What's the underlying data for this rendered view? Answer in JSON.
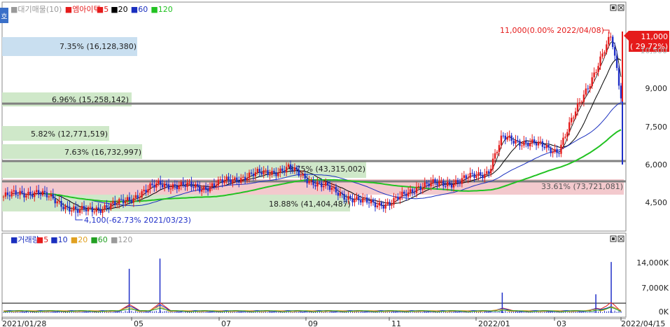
{
  "colors": {
    "up": "#e51b1b",
    "down": "#2030c8",
    "ma5": "#000000",
    "ma20": "#000000",
    "ma60": "#1a2fbf",
    "ma120": "#22c222",
    "band_green": "#cfe8c9",
    "band_pink": "#f3c9cd",
    "band_blue": "#c9dff0",
    "level_line": "#888888",
    "price_tag": "#e51b1b"
  },
  "price_panel": {
    "legend": [
      {
        "text": "■대기매물(10)",
        "color": "#9a9a9a"
      },
      {
        "text": "■엠아이텍",
        "color": "#e51b1b"
      },
      {
        "text": "■5",
        "color": "#e51b1b"
      },
      {
        "text": "■20",
        "color": "#000000"
      },
      {
        "text": "■60",
        "color": "#1a2fbf"
      },
      {
        "text": "■120",
        "color": "#22c222"
      }
    ],
    "side_tab": "호",
    "y_ticks": [
      "9,000",
      "7,500",
      "6,000",
      "4,500"
    ],
    "price_tag": {
      "line1": "11,000",
      "line2": "( 29.72%)"
    },
    "max_annotation": "11,000(0.00% 2022/04/08)",
    "min_annotation": "4,100(-62.73% 2021/03/23)",
    "volume_profile": [
      {
        "label": "7.35% (16,128,380)",
        "color": "blue"
      },
      {
        "label": "6.96% (15,258,142)",
        "color": "green"
      },
      {
        "label": "5.82% (12,771,519)",
        "color": "green"
      },
      {
        "label": "7.63% (16,732,997)",
        "color": "green"
      },
      {
        "label": "9.75% (43,315,002)",
        "color": "green"
      },
      {
        "label": "33.61% (73,721,081)",
        "color": "pink"
      },
      {
        "label": "18.88% (41,404,487)",
        "color": "green"
      }
    ]
  },
  "volume_panel": {
    "legend": [
      {
        "text": "■거래량",
        "color": "#1a2fbf"
      },
      {
        "text": "■5",
        "color": "#e51b1b"
      },
      {
        "text": "■10",
        "color": "#1a2fbf"
      },
      {
        "text": "■20",
        "color": "#e0a020"
      },
      {
        "text": "■60",
        "color": "#22a022"
      },
      {
        "text": "■120",
        "color": "#9a9a9a"
      }
    ],
    "y_ticks": [
      "14,000K",
      "7,000K",
      "0K"
    ]
  },
  "x_labels": [
    "2021/01/28",
    "05",
    "07",
    "09",
    "11",
    "2022/01",
    "03",
    "2022/04/15"
  ],
  "chart_data": {
    "type": "candlestick",
    "title": "엠아이텍",
    "period": [
      "2021/01/28",
      "2022/04/15"
    ],
    "ylim": [
      3000,
      11600
    ],
    "y_ticks": [
      4500,
      6000,
      7500,
      9000
    ],
    "moving_averages": [
      5,
      20,
      60,
      120
    ],
    "close_series_approx": [
      {
        "date": "2021/01/28",
        "close": 4700
      },
      {
        "date": "2021/02/20",
        "close": 4900
      },
      {
        "date": "2021/03/23",
        "close": 4100
      },
      {
        "date": "2021/04/20",
        "close": 4400
      },
      {
        "date": "2021/05/20",
        "close": 5200
      },
      {
        "date": "2021/06/20",
        "close": 5050
      },
      {
        "date": "2021/07/20",
        "close": 5500
      },
      {
        "date": "2021/08/20",
        "close": 5800
      },
      {
        "date": "2021/09/10",
        "close": 5200
      },
      {
        "date": "2021/10/10",
        "close": 4500
      },
      {
        "date": "2021/11/01",
        "close": 4400
      },
      {
        "date": "2021/11/20",
        "close": 5100
      },
      {
        "date": "2021/12/20",
        "close": 5300
      },
      {
        "date": "2022/01/10",
        "close": 5700
      },
      {
        "date": "2022/01/20",
        "close": 7000
      },
      {
        "date": "2022/02/10",
        "close": 6800
      },
      {
        "date": "2022/03/01",
        "close": 6500
      },
      {
        "date": "2022/03/20",
        "close": 8800
      },
      {
        "date": "2022/04/08",
        "close": 11000
      },
      {
        "date": "2022/04/15",
        "close": 8700
      }
    ],
    "last_price": 11000,
    "last_change_pct": 29.72,
    "period_high": {
      "price": 11000,
      "pct": 0.0,
      "date": "2022/04/08"
    },
    "period_low": {
      "price": 4100,
      "pct": -62.73,
      "date": "2021/03/23"
    },
    "volume_profile": [
      {
        "pct": 7.35,
        "volume": 16128380
      },
      {
        "pct": 6.96,
        "volume": 15258142
      },
      {
        "pct": 5.82,
        "volume": 12771519
      },
      {
        "pct": 7.63,
        "volume": 16732997
      },
      {
        "pct": 9.75,
        "volume": 43315002
      },
      {
        "pct": 33.61,
        "volume": 73721081
      },
      {
        "pct": 18.88,
        "volume": 41404487
      }
    ],
    "volume": {
      "unit": "K",
      "y_ticks": [
        0,
        7000,
        14000
      ],
      "spikes_approx": [
        {
          "date": "2021/04/28",
          "value": 13000
        },
        {
          "date": "2021/05/20",
          "value": 16000
        },
        {
          "date": "2022/01/20",
          "value": 6000
        },
        {
          "date": "2022/03/28",
          "value": 5500
        },
        {
          "date": "2022/04/08",
          "value": 15000
        }
      ]
    }
  }
}
